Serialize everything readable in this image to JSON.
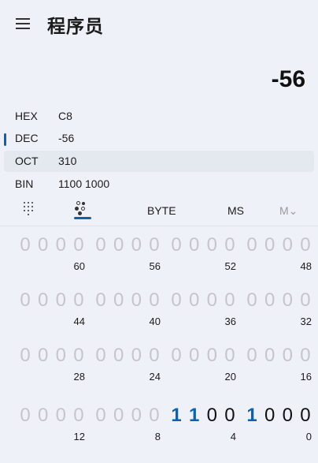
{
  "header": {
    "title": "程序员",
    "menu_icon": "hamburger-icon"
  },
  "display": {
    "value": "-56"
  },
  "radix": [
    {
      "label": "HEX",
      "value": "C8",
      "selected": false
    },
    {
      "label": "DEC",
      "value": "-56",
      "selected": false,
      "indicator": true
    },
    {
      "label": "OCT",
      "value": "310",
      "selected": true
    },
    {
      "label": "BIN",
      "value": "1100 1000",
      "selected": false
    }
  ],
  "toolbar": {
    "keypad_icon": "full-keypad-icon",
    "bits_icon": "bit-toggling-keypad-icon",
    "word_size": "BYTE",
    "memory_store": "MS",
    "memory_menu": "M⌄"
  },
  "colors": {
    "accent": "#0a63b0",
    "inactive_bit": "#c4c6ca",
    "background": "#eef2f8"
  },
  "bit_rows": [
    {
      "groups": [
        {
          "bits": [
            "0",
            "0",
            "0",
            "0"
          ],
          "states": [
            "off",
            "off",
            "off",
            "off"
          ],
          "position": "60"
        },
        {
          "bits": [
            "0",
            "0",
            "0",
            "0"
          ],
          "states": [
            "off",
            "off",
            "off",
            "off"
          ],
          "position": "56"
        },
        {
          "bits": [
            "0",
            "0",
            "0",
            "0"
          ],
          "states": [
            "off",
            "off",
            "off",
            "off"
          ],
          "position": "52"
        },
        {
          "bits": [
            "0",
            "0",
            "0",
            "0"
          ],
          "states": [
            "off",
            "off",
            "off",
            "off"
          ],
          "position": "48"
        }
      ]
    },
    {
      "groups": [
        {
          "bits": [
            "0",
            "0",
            "0",
            "0"
          ],
          "states": [
            "off",
            "off",
            "off",
            "off"
          ],
          "position": "44"
        },
        {
          "bits": [
            "0",
            "0",
            "0",
            "0"
          ],
          "states": [
            "off",
            "off",
            "off",
            "off"
          ],
          "position": "40"
        },
        {
          "bits": [
            "0",
            "0",
            "0",
            "0"
          ],
          "states": [
            "off",
            "off",
            "off",
            "off"
          ],
          "position": "36"
        },
        {
          "bits": [
            "0",
            "0",
            "0",
            "0"
          ],
          "states": [
            "off",
            "off",
            "off",
            "off"
          ],
          "position": "32"
        }
      ]
    },
    {
      "groups": [
        {
          "bits": [
            "0",
            "0",
            "0",
            "0"
          ],
          "states": [
            "off",
            "off",
            "off",
            "off"
          ],
          "position": "28"
        },
        {
          "bits": [
            "0",
            "0",
            "0",
            "0"
          ],
          "states": [
            "off",
            "off",
            "off",
            "off"
          ],
          "position": "24"
        },
        {
          "bits": [
            "0",
            "0",
            "0",
            "0"
          ],
          "states": [
            "off",
            "off",
            "off",
            "off"
          ],
          "position": "20"
        },
        {
          "bits": [
            "0",
            "0",
            "0",
            "0"
          ],
          "states": [
            "off",
            "off",
            "off",
            "off"
          ],
          "position": "16"
        }
      ]
    },
    {
      "groups": [
        {
          "bits": [
            "0",
            "0",
            "0",
            "0"
          ],
          "states": [
            "off",
            "off",
            "off",
            "off"
          ],
          "position": "12"
        },
        {
          "bits": [
            "0",
            "0",
            "0",
            "0"
          ],
          "states": [
            "off",
            "off",
            "off",
            "off"
          ],
          "position": "8"
        },
        {
          "bits": [
            "1",
            "1",
            "0",
            "0"
          ],
          "states": [
            "on",
            "on",
            "dark",
            "dark"
          ],
          "position": "4"
        },
        {
          "bits": [
            "1",
            "0",
            "0",
            "0"
          ],
          "states": [
            "on",
            "dark",
            "dark",
            "dark"
          ],
          "position": "0"
        }
      ]
    }
  ]
}
